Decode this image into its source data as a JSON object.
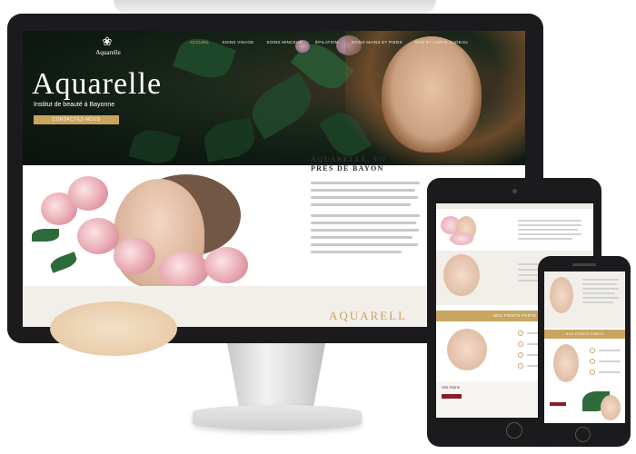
{
  "site": {
    "logo_text": "Aquarelle",
    "nav": [
      {
        "label": "Accueil",
        "active": true
      },
      {
        "label": "Soins visage",
        "active": false
      },
      {
        "label": "Soins minceur",
        "active": false
      },
      {
        "label": "Épilation",
        "active": false
      },
      {
        "label": "Soins mains et pieds",
        "active": false
      },
      {
        "label": "Bon et carte cadeau",
        "active": false
      }
    ],
    "hero": {
      "title": "Aquarelle",
      "subtitle": "Institut de beauté à Bayonne",
      "button": "Contactez-nous"
    },
    "section2": {
      "title_line1": "AQUARELLE, VO",
      "title_line2": "PRÈS DE BAYON"
    },
    "section3": {
      "title": "AQUARELL"
    },
    "tablet": {
      "points_forts": "NOS POINTS FORTS",
      "card_title": "Vos Soins"
    },
    "phone": {
      "points_forts": "NOS POINTS FORTS"
    }
  },
  "colors": {
    "accent_gold": "#c9a560",
    "device_frame": "#1b1b1d",
    "hero_dark_green": "#0f1a12"
  }
}
